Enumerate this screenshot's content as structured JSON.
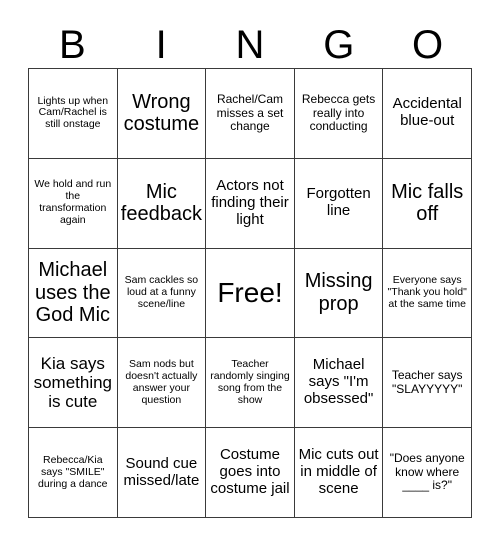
{
  "header": {
    "letters": [
      "B",
      "I",
      "N",
      "G",
      "O"
    ]
  },
  "grid": {
    "rows": 5,
    "columns": 5,
    "border_color": "#3a3a3a",
    "background_color": "#ffffff",
    "text_color": "#000000",
    "cells": [
      {
        "text": "Lights up when Cam/Rachel is still onstage",
        "size": "xs"
      },
      {
        "text": "Wrong costume",
        "size": "xl"
      },
      {
        "text": "Rachel/Cam misses a set change",
        "size": "s"
      },
      {
        "text": "Rebecca gets really into conducting",
        "size": "s"
      },
      {
        "text": "Accidental blue-out",
        "size": "m"
      },
      {
        "text": "We hold and run the transformation again",
        "size": "xs"
      },
      {
        "text": "Mic feedback",
        "size": "xl"
      },
      {
        "text": "Actors not finding their light",
        "size": "m"
      },
      {
        "text": "Forgotten line",
        "size": "m"
      },
      {
        "text": "Mic falls off",
        "size": "xl"
      },
      {
        "text": "Michael uses the God Mic",
        "size": "xl"
      },
      {
        "text": "Sam cackles so loud at a funny scene/line",
        "size": "xs"
      },
      {
        "text": "Free!",
        "size": "xxl"
      },
      {
        "text": "Missing prop",
        "size": "xl"
      },
      {
        "text": "Everyone says \"Thank you hold\" at the same time",
        "size": "xs"
      },
      {
        "text": "Kia says something is cute",
        "size": "l"
      },
      {
        "text": "Sam nods but doesn't actually answer your question",
        "size": "xs"
      },
      {
        "text": "Teacher randomly singing song from the show",
        "size": "xs"
      },
      {
        "text": "Michael says \"I'm obsessed\"",
        "size": "m"
      },
      {
        "text": "Teacher says \"SLAYYYYY\"",
        "size": "s"
      },
      {
        "text": "Rebecca/Kia says \"SMILE\" during a dance",
        "size": "xs"
      },
      {
        "text": "Sound cue missed/late",
        "size": "m"
      },
      {
        "text": "Costume goes into costume jail",
        "size": "m"
      },
      {
        "text": "Mic cuts out in middle of scene",
        "size": "m"
      },
      {
        "text": "\"Does anyone know where ____ is?\"",
        "size": "s"
      }
    ]
  }
}
